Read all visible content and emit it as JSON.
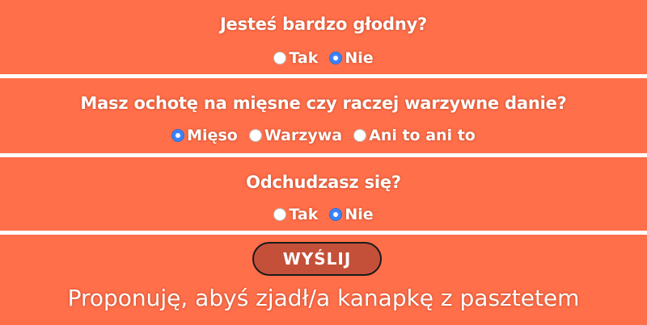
{
  "accent_color": "#ff6f4a",
  "button_color": "#c4503a",
  "radio_checked_color": "#3b82f6",
  "questions": [
    {
      "title": "Jesteś bardzo głodny?",
      "options": [
        {
          "label": "Tak",
          "checked": false
        },
        {
          "label": "Nie",
          "checked": true
        }
      ]
    },
    {
      "title": "Masz ochotę na mięsne czy raczej warzywne danie?",
      "options": [
        {
          "label": "Mięso",
          "checked": true
        },
        {
          "label": "Warzywa",
          "checked": false
        },
        {
          "label": "Ani to ani to",
          "checked": false
        }
      ]
    },
    {
      "title": "Odchudzasz się?",
      "options": [
        {
          "label": "Tak",
          "checked": false
        },
        {
          "label": "Nie",
          "checked": true
        }
      ]
    }
  ],
  "submit_label": "WYŚLIJ",
  "result": "Proponuję, abyś zjadł/a kanapkę z pasztetem"
}
